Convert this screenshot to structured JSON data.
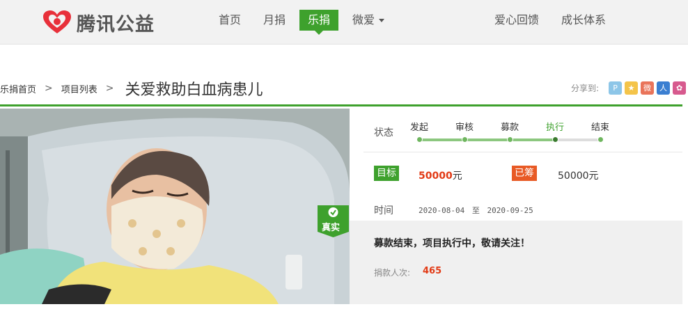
{
  "header": {
    "logo_text": "腾讯公益",
    "nav": [
      {
        "label": "首页"
      },
      {
        "label": "月捐"
      },
      {
        "label": "乐捐"
      },
      {
        "label": "微爱"
      }
    ],
    "nav_right": [
      {
        "label": "爱心回馈"
      },
      {
        "label": "成长体系"
      }
    ],
    "active_color": "#3ea12d"
  },
  "breadcrumb": {
    "items": [
      "乐捐首页",
      "项目列表"
    ],
    "title": "关爱救助白血病患儿"
  },
  "share": {
    "label": "分享到:",
    "buttons": [
      {
        "icon": "pengyou-icon",
        "color": "#8dc6e8",
        "glyph": "P"
      },
      {
        "icon": "qzone-icon",
        "color": "#f4c44a",
        "glyph": "★"
      },
      {
        "icon": "weibo-icon",
        "color": "#e9745a",
        "glyph": "微"
      },
      {
        "icon": "renren-icon",
        "color": "#3b7fd1",
        "glyph": "人"
      },
      {
        "icon": "kaixin-icon",
        "color": "#d75a8e",
        "glyph": "✿"
      }
    ]
  },
  "project": {
    "badge_text": "真实",
    "status_label": "状态",
    "steps": [
      "发起",
      "审核",
      "募款",
      "执行",
      "结束"
    ],
    "current_step": 3,
    "target_tag": "目标",
    "target_value": "50000",
    "raised_tag": "已筹",
    "raised_value": "50000",
    "currency": "元",
    "time_label": "时间",
    "start_date": "2020-08-04",
    "to": "至",
    "end_date": "2020-09-25",
    "status_message": "募款结束，项目执行中，敬请关注！",
    "donors_label": "捐款人次:",
    "donors_value": "465"
  }
}
